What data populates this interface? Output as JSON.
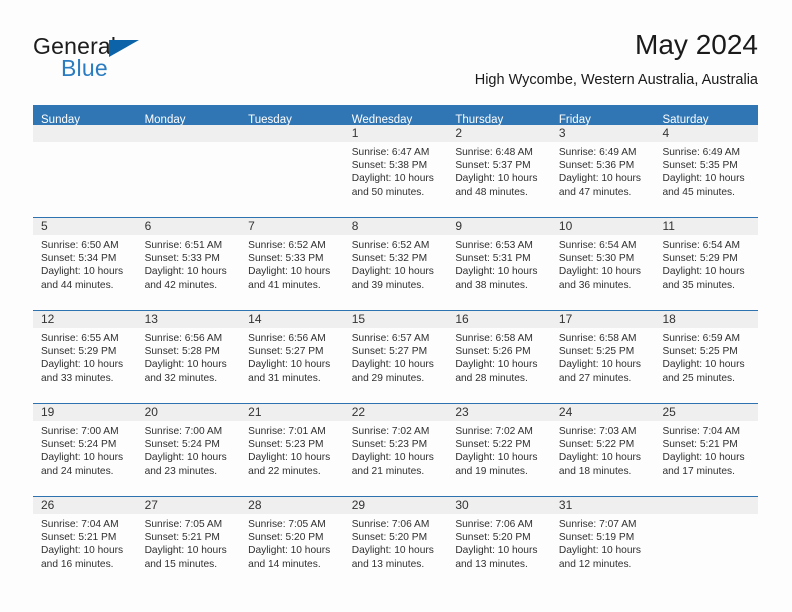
{
  "brand": {
    "name_top": "General",
    "name_bottom": "Blue",
    "accent_color": "#2b7cc0",
    "flag_color": "#0c63a8"
  },
  "header": {
    "title": "May 2024",
    "subtitle": "High Wycombe, Western Australia, Australia"
  },
  "theme": {
    "header_row_bg": "#3075b4",
    "week_border": "#2e72b0",
    "daynum_bg": "#efefef",
    "page_bg": "#fdfdfd"
  },
  "calendar": {
    "day_headers": [
      "Sunday",
      "Monday",
      "Tuesday",
      "Wednesday",
      "Thursday",
      "Friday",
      "Saturday"
    ],
    "labels": {
      "sunrise": "Sunrise:",
      "sunset": "Sunset:",
      "daylight": "Daylight:"
    },
    "weeks": [
      [
        {
          "day": "",
          "empty": true
        },
        {
          "day": "",
          "empty": true
        },
        {
          "day": "",
          "empty": true
        },
        {
          "day": "1",
          "sunrise": "Sunrise: 6:47 AM",
          "sunset": "Sunset: 5:38 PM",
          "daylight1": "Daylight: 10 hours",
          "daylight2": "and 50 minutes."
        },
        {
          "day": "2",
          "sunrise": "Sunrise: 6:48 AM",
          "sunset": "Sunset: 5:37 PM",
          "daylight1": "Daylight: 10 hours",
          "daylight2": "and 48 minutes."
        },
        {
          "day": "3",
          "sunrise": "Sunrise: 6:49 AM",
          "sunset": "Sunset: 5:36 PM",
          "daylight1": "Daylight: 10 hours",
          "daylight2": "and 47 minutes."
        },
        {
          "day": "4",
          "sunrise": "Sunrise: 6:49 AM",
          "sunset": "Sunset: 5:35 PM",
          "daylight1": "Daylight: 10 hours",
          "daylight2": "and 45 minutes."
        }
      ],
      [
        {
          "day": "5",
          "sunrise": "Sunrise: 6:50 AM",
          "sunset": "Sunset: 5:34 PM",
          "daylight1": "Daylight: 10 hours",
          "daylight2": "and 44 minutes."
        },
        {
          "day": "6",
          "sunrise": "Sunrise: 6:51 AM",
          "sunset": "Sunset: 5:33 PM",
          "daylight1": "Daylight: 10 hours",
          "daylight2": "and 42 minutes."
        },
        {
          "day": "7",
          "sunrise": "Sunrise: 6:52 AM",
          "sunset": "Sunset: 5:33 PM",
          "daylight1": "Daylight: 10 hours",
          "daylight2": "and 41 minutes."
        },
        {
          "day": "8",
          "sunrise": "Sunrise: 6:52 AM",
          "sunset": "Sunset: 5:32 PM",
          "daylight1": "Daylight: 10 hours",
          "daylight2": "and 39 minutes."
        },
        {
          "day": "9",
          "sunrise": "Sunrise: 6:53 AM",
          "sunset": "Sunset: 5:31 PM",
          "daylight1": "Daylight: 10 hours",
          "daylight2": "and 38 minutes."
        },
        {
          "day": "10",
          "sunrise": "Sunrise: 6:54 AM",
          "sunset": "Sunset: 5:30 PM",
          "daylight1": "Daylight: 10 hours",
          "daylight2": "and 36 minutes."
        },
        {
          "day": "11",
          "sunrise": "Sunrise: 6:54 AM",
          "sunset": "Sunset: 5:29 PM",
          "daylight1": "Daylight: 10 hours",
          "daylight2": "and 35 minutes."
        }
      ],
      [
        {
          "day": "12",
          "sunrise": "Sunrise: 6:55 AM",
          "sunset": "Sunset: 5:29 PM",
          "daylight1": "Daylight: 10 hours",
          "daylight2": "and 33 minutes."
        },
        {
          "day": "13",
          "sunrise": "Sunrise: 6:56 AM",
          "sunset": "Sunset: 5:28 PM",
          "daylight1": "Daylight: 10 hours",
          "daylight2": "and 32 minutes."
        },
        {
          "day": "14",
          "sunrise": "Sunrise: 6:56 AM",
          "sunset": "Sunset: 5:27 PM",
          "daylight1": "Daylight: 10 hours",
          "daylight2": "and 31 minutes."
        },
        {
          "day": "15",
          "sunrise": "Sunrise: 6:57 AM",
          "sunset": "Sunset: 5:27 PM",
          "daylight1": "Daylight: 10 hours",
          "daylight2": "and 29 minutes."
        },
        {
          "day": "16",
          "sunrise": "Sunrise: 6:58 AM",
          "sunset": "Sunset: 5:26 PM",
          "daylight1": "Daylight: 10 hours",
          "daylight2": "and 28 minutes."
        },
        {
          "day": "17",
          "sunrise": "Sunrise: 6:58 AM",
          "sunset": "Sunset: 5:25 PM",
          "daylight1": "Daylight: 10 hours",
          "daylight2": "and 27 minutes."
        },
        {
          "day": "18",
          "sunrise": "Sunrise: 6:59 AM",
          "sunset": "Sunset: 5:25 PM",
          "daylight1": "Daylight: 10 hours",
          "daylight2": "and 25 minutes."
        }
      ],
      [
        {
          "day": "19",
          "sunrise": "Sunrise: 7:00 AM",
          "sunset": "Sunset: 5:24 PM",
          "daylight1": "Daylight: 10 hours",
          "daylight2": "and 24 minutes."
        },
        {
          "day": "20",
          "sunrise": "Sunrise: 7:00 AM",
          "sunset": "Sunset: 5:24 PM",
          "daylight1": "Daylight: 10 hours",
          "daylight2": "and 23 minutes."
        },
        {
          "day": "21",
          "sunrise": "Sunrise: 7:01 AM",
          "sunset": "Sunset: 5:23 PM",
          "daylight1": "Daylight: 10 hours",
          "daylight2": "and 22 minutes."
        },
        {
          "day": "22",
          "sunrise": "Sunrise: 7:02 AM",
          "sunset": "Sunset: 5:23 PM",
          "daylight1": "Daylight: 10 hours",
          "daylight2": "and 21 minutes."
        },
        {
          "day": "23",
          "sunrise": "Sunrise: 7:02 AM",
          "sunset": "Sunset: 5:22 PM",
          "daylight1": "Daylight: 10 hours",
          "daylight2": "and 19 minutes."
        },
        {
          "day": "24",
          "sunrise": "Sunrise: 7:03 AM",
          "sunset": "Sunset: 5:22 PM",
          "daylight1": "Daylight: 10 hours",
          "daylight2": "and 18 minutes."
        },
        {
          "day": "25",
          "sunrise": "Sunrise: 7:04 AM",
          "sunset": "Sunset: 5:21 PM",
          "daylight1": "Daylight: 10 hours",
          "daylight2": "and 17 minutes."
        }
      ],
      [
        {
          "day": "26",
          "sunrise": "Sunrise: 7:04 AM",
          "sunset": "Sunset: 5:21 PM",
          "daylight1": "Daylight: 10 hours",
          "daylight2": "and 16 minutes."
        },
        {
          "day": "27",
          "sunrise": "Sunrise: 7:05 AM",
          "sunset": "Sunset: 5:21 PM",
          "daylight1": "Daylight: 10 hours",
          "daylight2": "and 15 minutes."
        },
        {
          "day": "28",
          "sunrise": "Sunrise: 7:05 AM",
          "sunset": "Sunset: 5:20 PM",
          "daylight1": "Daylight: 10 hours",
          "daylight2": "and 14 minutes."
        },
        {
          "day": "29",
          "sunrise": "Sunrise: 7:06 AM",
          "sunset": "Sunset: 5:20 PM",
          "daylight1": "Daylight: 10 hours",
          "daylight2": "and 13 minutes."
        },
        {
          "day": "30",
          "sunrise": "Sunrise: 7:06 AM",
          "sunset": "Sunset: 5:20 PM",
          "daylight1": "Daylight: 10 hours",
          "daylight2": "and 13 minutes."
        },
        {
          "day": "31",
          "sunrise": "Sunrise: 7:07 AM",
          "sunset": "Sunset: 5:19 PM",
          "daylight1": "Daylight: 10 hours",
          "daylight2": "and 12 minutes."
        },
        {
          "day": "",
          "empty": true
        }
      ]
    ]
  }
}
